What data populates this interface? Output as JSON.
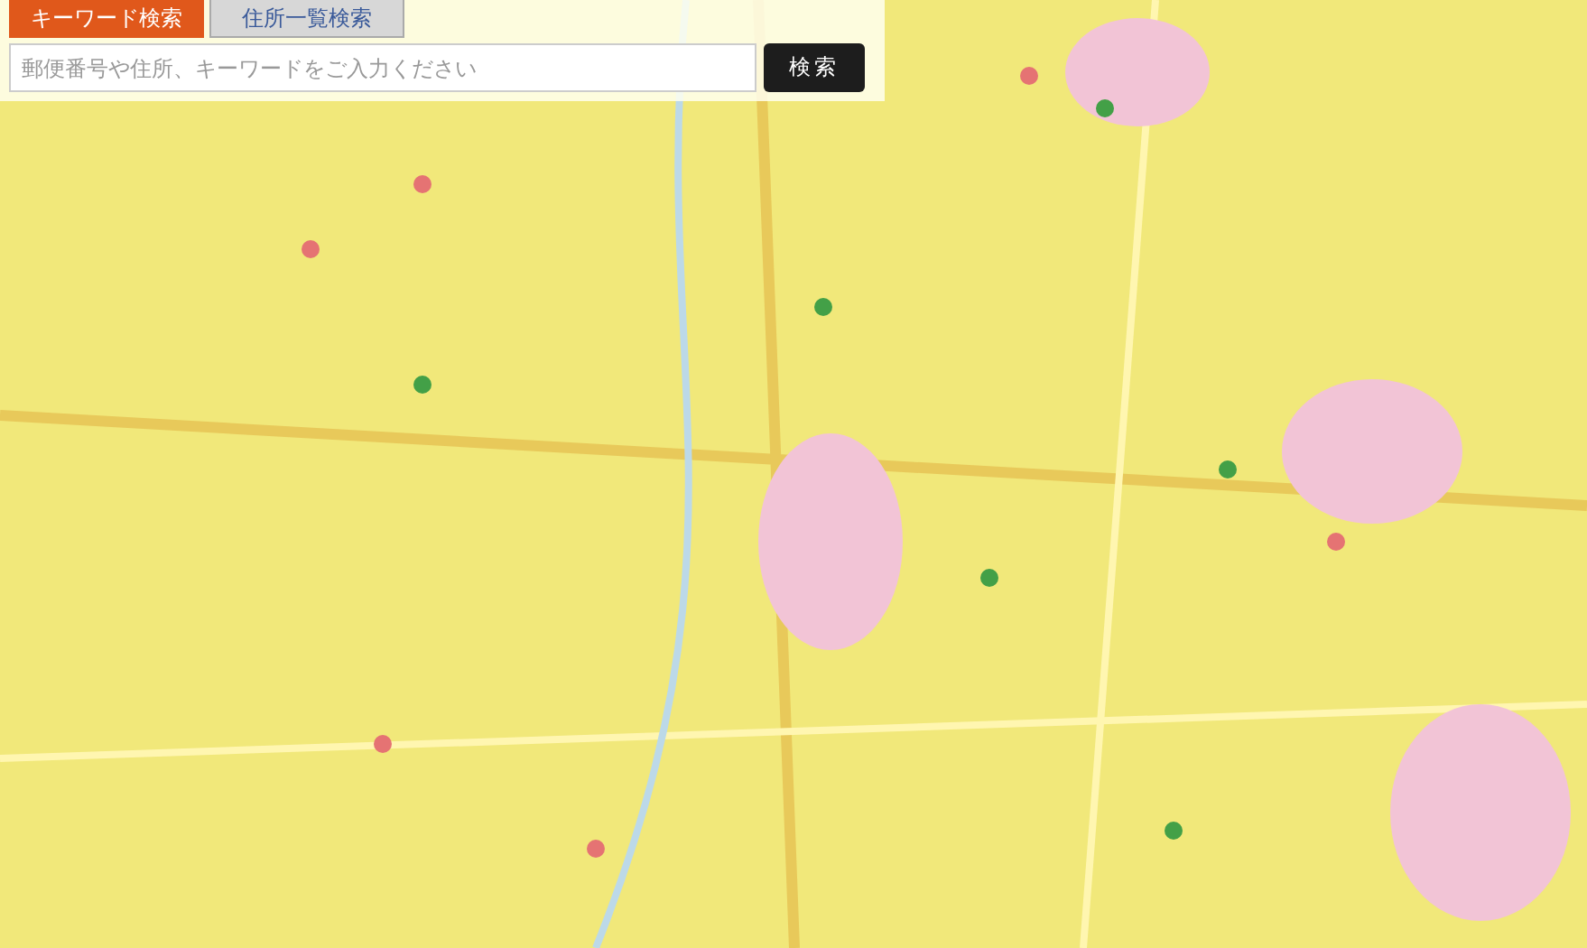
{
  "search_panel": {
    "tabs": [
      {
        "label": "キーワード検索",
        "selected": true
      },
      {
        "label": "住所一覧検索",
        "selected": false
      }
    ],
    "search": {
      "placeholder": "郵便番号や住所、キーワードをご入力ください"
    },
    "button": "検索"
  }
}
